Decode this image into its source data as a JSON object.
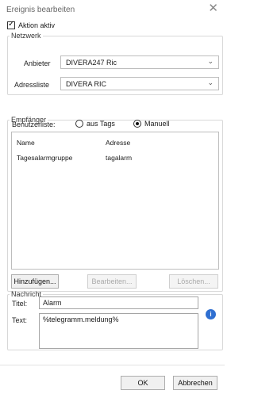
{
  "window": {
    "title": "Ereignis bearbeiten",
    "close_icon": "close-icon"
  },
  "aktion": {
    "label": "Aktion aktiv",
    "checked": true
  },
  "netzwerk": {
    "legend": "Netzwerk",
    "anbieter_label": "Anbieter",
    "anbieter_value": "DIVERA247 Ric",
    "adressliste_label": "Adressliste",
    "adressliste_value": "DIVERA RIC"
  },
  "empfaenger": {
    "legend": "Empfänger",
    "benutzerliste_label": "Benutzerliste:",
    "radio_tags": "aus Tags",
    "radio_manuell": "Manuell",
    "selected": "Manuell",
    "columns": [
      "Name",
      "Adresse"
    ],
    "rows": [
      {
        "name": "Tagesalarmgruppe",
        "adresse": "tagalarm"
      }
    ],
    "buttons": {
      "add": "Hinzufügen...",
      "edit": "Bearbeiten...",
      "delete": "Löschen..."
    }
  },
  "nachricht": {
    "legend": "Nachricht",
    "titel_label": "Titel:",
    "titel_value": "Alarm",
    "text_label": "Text:",
    "text_value": "%telegramm.meldung%"
  },
  "footer": {
    "ok": "OK",
    "cancel": "Abbrechen"
  }
}
